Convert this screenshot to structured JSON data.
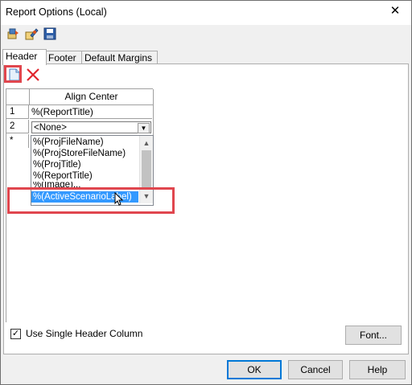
{
  "window": {
    "title": "Report Options (Local)",
    "close_glyph": "✕"
  },
  "toolbar": {
    "icons": [
      "open-icon",
      "edit-icon",
      "save-icon"
    ]
  },
  "tabs": [
    {
      "label": "Header",
      "active": true
    },
    {
      "label": "Footer",
      "active": false
    },
    {
      "label": "Default Margins",
      "active": false
    }
  ],
  "grid": {
    "column_header": "Align Center",
    "rows": [
      {
        "num": "1",
        "value": "%(ReportTitle)"
      },
      {
        "num": "2",
        "value": "<None>"
      },
      {
        "num": "*",
        "value": ""
      }
    ]
  },
  "dropdown": {
    "items": [
      "%(ProjFileName)",
      "%(ProjStoreFileName)",
      "%(ProjTitle)",
      "%(ReportTitle)",
      "%(Image)...",
      "%(ActiveScenarioLabel)"
    ],
    "selected": "%(ActiveScenarioLabel)"
  },
  "options": {
    "single_header_label": "Use Single Header Column",
    "single_header_checked": true,
    "check_glyph": "✓"
  },
  "buttons": {
    "font": "Font...",
    "ok": "OK",
    "cancel": "Cancel",
    "help": "Help"
  },
  "highlight_color": "#e0464e",
  "selection_color": "#3399ff"
}
